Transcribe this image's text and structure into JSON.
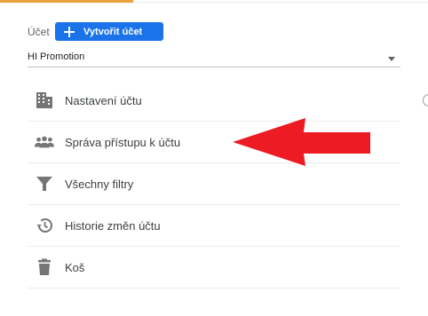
{
  "account": {
    "label": "Účet",
    "create_button_label": "Vytvořit účet",
    "selected_account": "HI Promotion"
  },
  "menu": {
    "items": [
      {
        "label": "Nastavení účtu",
        "icon": "building-icon"
      },
      {
        "label": "Správa přístupu k účtu",
        "icon": "people-icon"
      },
      {
        "label": "Všechny filtry",
        "icon": "filter-icon"
      },
      {
        "label": "Historie změn účtu",
        "icon": "history-icon"
      },
      {
        "label": "Koš",
        "icon": "trash-icon"
      }
    ]
  },
  "colors": {
    "primary": "#1a73e8",
    "accent": "#e9a23b",
    "annotation_arrow": "#ed1c24",
    "icon_gray": "#757575"
  }
}
